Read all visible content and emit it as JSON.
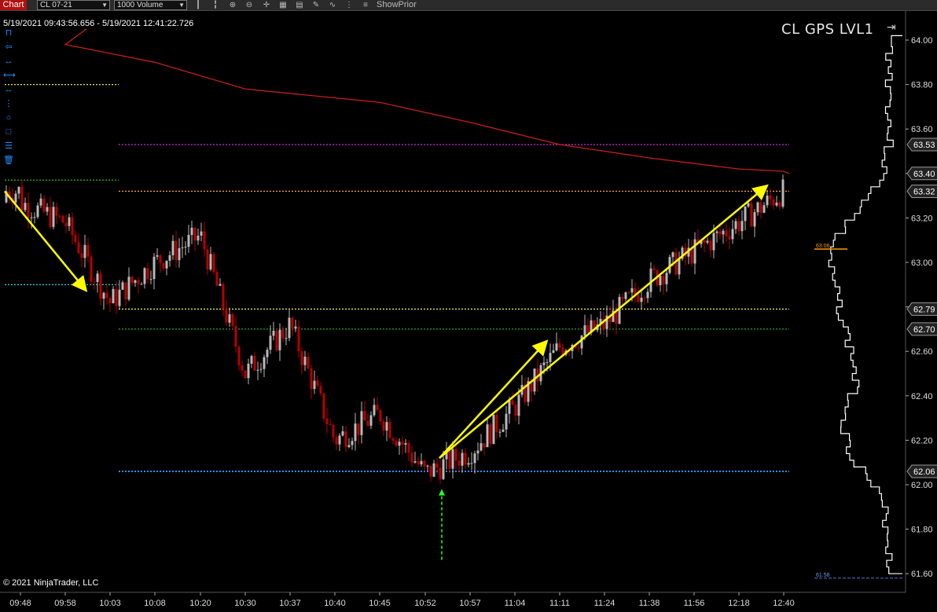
{
  "toolbar": {
    "tab": "Chart",
    "instrument": "CL 07-21",
    "bar_type": "1000 Volume",
    "show_prior": "ShowPrior",
    "icons": [
      "bar-style-icon",
      "bar-style-2-icon",
      "zoom-in-icon",
      "zoom-out-icon",
      "crosshair-icon",
      "data-box-icon",
      "properties-icon",
      "drawing-tools-icon",
      "strategies-icon",
      "indicators-icon"
    ]
  },
  "header": {
    "date_range": "5/19/2021 09:43:56.656 - 5/19/2021 12:41:22.726",
    "title": "CL GPS LVL1"
  },
  "footer": {
    "copyright": "© 2021 NinjaTrader, LLC"
  },
  "left_tools": [
    "ruler-icon",
    "arrow-left-icon",
    "arrow-line-icon",
    "horizontal-line-icon",
    "extended-line-icon",
    "vertical-line-icon",
    "ellipse-icon",
    "rectangle-icon",
    "fib-icon",
    "trash-icon"
  ],
  "colors": {
    "up": "#b8b8b8",
    "down": "#b80000",
    "sma": "#c41e1e",
    "arrow": "#ffff00",
    "profile": "#ffffff",
    "level_magenta": "#e020e0",
    "level_orange": "#ff9933",
    "level_yellow": "#e8e84a",
    "level_green": "#1fae1f",
    "level_cyan": "#20c8e0",
    "level_blue": "#2e8fff"
  },
  "chart_data": {
    "type": "candlestick",
    "title": "CL GPS LVL1",
    "y_ticks": [
      64.0,
      63.8,
      63.6,
      63.4,
      63.2,
      63.0,
      62.8,
      62.6,
      62.4,
      62.2,
      62.0,
      61.8,
      61.6
    ],
    "ylim": [
      61.6,
      64.0
    ],
    "x_ticks": [
      "09:48",
      "09:58",
      "10:03",
      "10:08",
      "10:20",
      "10:30",
      "10:37",
      "10:40",
      "10:45",
      "10:52",
      "10:57",
      "11:04",
      "11:11",
      "11:24",
      "11:38",
      "11:56",
      "12:18",
      "12:40"
    ],
    "price_path": [
      [
        "09:48",
        63.27
      ],
      [
        "09:58",
        63.18
      ],
      [
        "10:03",
        62.82
      ],
      [
        "10:08",
        63.0
      ],
      [
        "10:20",
        63.12
      ],
      [
        "10:30",
        62.5
      ],
      [
        "10:37",
        62.72
      ],
      [
        "10:40",
        62.2
      ],
      [
        "10:45",
        62.32
      ],
      [
        "10:52",
        62.05
      ],
      [
        "10:57",
        62.15
      ],
      [
        "11:04",
        62.35
      ],
      [
        "11:11",
        62.62
      ],
      [
        "11:24",
        62.72
      ],
      [
        "11:38",
        62.92
      ],
      [
        "11:56",
        63.05
      ],
      [
        "12:18",
        63.18
      ],
      [
        "12:40",
        63.32
      ]
    ],
    "sma_path": [
      [
        "09:48",
        64.05
      ],
      [
        "09:58",
        63.98
      ],
      [
        "10:08",
        63.9
      ],
      [
        "10:30",
        63.78
      ],
      [
        "10:45",
        63.72
      ],
      [
        "10:57",
        63.63
      ],
      [
        "11:11",
        63.53
      ],
      [
        "11:38",
        63.47
      ],
      [
        "12:18",
        63.42
      ],
      [
        "12:40",
        63.41
      ]
    ],
    "levels": [
      {
        "price": 63.8,
        "color": "level_yellow",
        "from": "09:48",
        "to": "10:03"
      },
      {
        "price": 63.53,
        "color": "level_magenta",
        "label": "63.53",
        "from": "10:03",
        "to": "12:40"
      },
      {
        "price": 63.37,
        "color": "level_green",
        "from": "09:48",
        "to": "10:03"
      },
      {
        "price": 63.32,
        "color": "level_orange",
        "label": "63.32",
        "from": "10:03",
        "to": "12:40"
      },
      {
        "price": 62.9,
        "color": "level_cyan",
        "from": "09:48",
        "to": "10:03"
      },
      {
        "price": 62.79,
        "color": "level_yellow",
        "label": "62.79",
        "from": "10:03",
        "to": "12:40"
      },
      {
        "price": 62.7,
        "color": "level_green",
        "label": "62.70",
        "from": "10:03",
        "to": "12:40"
      },
      {
        "price": 62.06,
        "color": "level_blue",
        "label": "62.06",
        "from": "10:03",
        "to": "12:40"
      }
    ],
    "current_price_label": "63.40",
    "poc_label": "63.06",
    "low_label": "61.58",
    "arrows": [
      {
        "from": [
          "09:48",
          63.32
        ],
        "to": [
          "10:03",
          62.88
        ]
      },
      {
        "from": [
          "10:52",
          62.12
        ],
        "to": [
          "11:11",
          62.64
        ]
      },
      {
        "from": [
          "10:52",
          62.12
        ],
        "to": [
          "12:18",
          63.34
        ]
      }
    ],
    "signal_arrow": {
      "time": "10:52",
      "price": 61.98
    }
  }
}
